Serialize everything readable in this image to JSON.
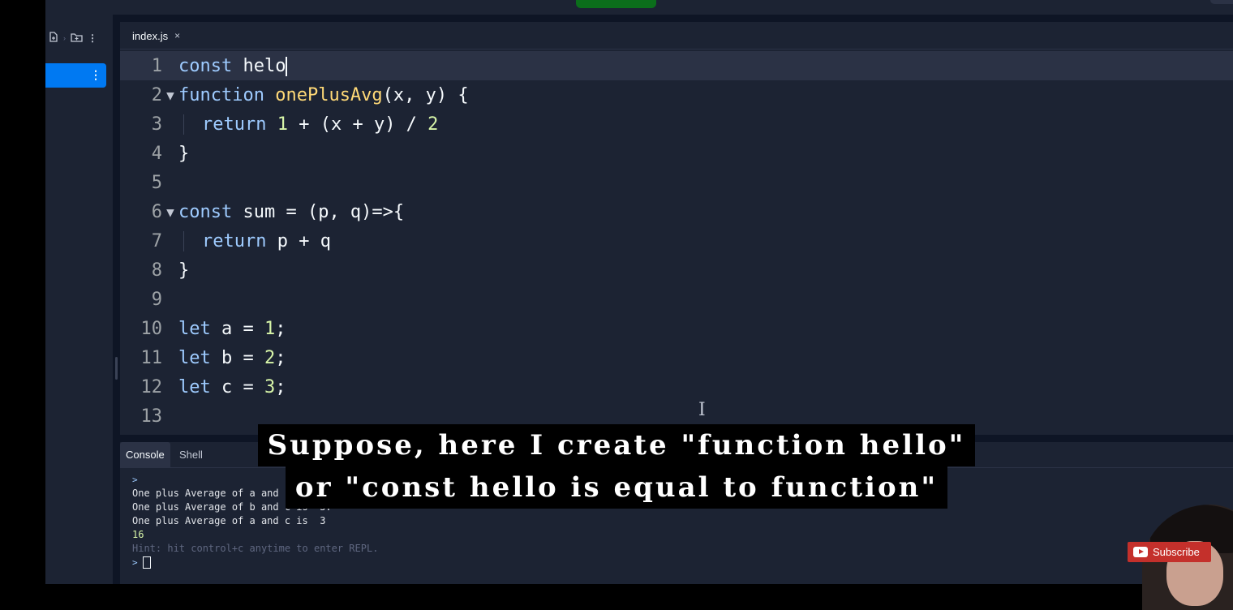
{
  "editor": {
    "tab_label": "index.js",
    "tab_close": "×",
    "lines": [
      {
        "n": "1"
      },
      {
        "n": "2"
      },
      {
        "n": "3"
      },
      {
        "n": "4"
      },
      {
        "n": "5"
      },
      {
        "n": "6"
      },
      {
        "n": "7"
      },
      {
        "n": "8"
      },
      {
        "n": "9"
      },
      {
        "n": "10"
      },
      {
        "n": "11"
      },
      {
        "n": "12"
      },
      {
        "n": "13"
      }
    ],
    "code": {
      "l1_kw": "const",
      "l1_rest": " helo",
      "l2_kw": "function",
      "l2_fn": "onePlusAvg",
      "l2_rest": "(x, y) {",
      "l3_kw": "return",
      "l3_n1": "1",
      "l3_mid": " + (x + y) / ",
      "l3_n2": "2",
      "l4": "}",
      "l6_kw": "const",
      "l6_rest": " sum = (p, q)=>{",
      "l7_kw": "return",
      "l7_rest": " p + q",
      "l8": "}",
      "l10_kw": "let",
      "l10_rest": " a = ",
      "l10_n": "1",
      "l10_end": ";",
      "l11_kw": "let",
      "l11_rest": " b = ",
      "l11_n": "2",
      "l11_end": ";",
      "l12_kw": "let",
      "l12_rest": " c = ",
      "l12_n": "3",
      "l12_end": ";"
    },
    "fold_marker": "▼",
    "text_cursor": "I"
  },
  "console": {
    "tabs": [
      "Console",
      "Shell"
    ],
    "prompt": ">",
    "output": [
      "One plus Average of a and b is  2.",
      "One plus Average of b and c is  3.",
      "One plus Average of a and c is  3"
    ],
    "result": "16",
    "hint": "Hint: hit control+c anytime to enter REPL.",
    "input_prompt": "> "
  },
  "caption": {
    "line1": "Suppose, here I create \"function hello\"",
    "line2": "or \"const hello is equal to function\""
  },
  "overlay": {
    "subscribe_label": "Subscribe"
  },
  "colors": {
    "editor_bg": "#1c2333",
    "keyword": "#9ecbff",
    "function_name": "#ffd977",
    "number": "#d7f5a8",
    "accent": "#0079f2",
    "run_button": "#0b6e1b",
    "subscribe": "#c4302b"
  }
}
